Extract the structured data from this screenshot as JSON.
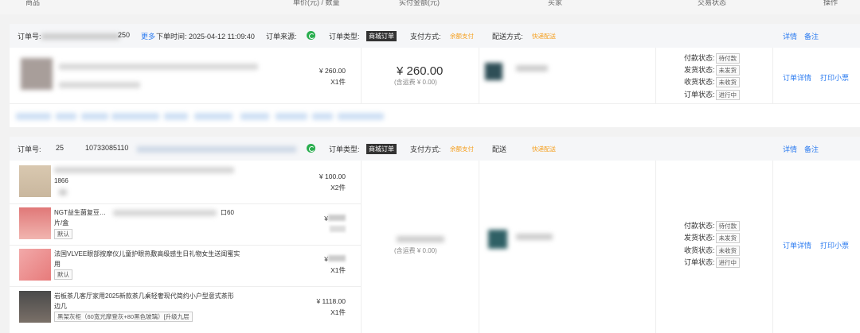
{
  "header": {
    "product": "商品",
    "unit_price_qty": "单价(元) / 数量",
    "paid": "实付金额(元)",
    "buyer": "买家",
    "trade_status": "交易状态",
    "action": "操作"
  },
  "order1": {
    "order_no_label": "订单号:",
    "order_no_suffix": "250",
    "more": "更多",
    "order_time": "下单时间: 2025-04-12 11:09:40",
    "source_label": "订单来源:",
    "type_label": "订单类型:",
    "type_value": "商城订单",
    "pay_label": "支付方式:",
    "pay_value": "余额支付",
    "ship_label": "配送方式:",
    "ship_value": "快递配送",
    "detail": "详情",
    "note": "备注",
    "item_price": "¥ 260.00",
    "item_qty": "X1件",
    "paid_amount": "¥ 260.00",
    "paid_shipping": "(含运费 ¥ 0.00)",
    "status": [
      {
        "label": "付款状态:",
        "value": "待付款"
      },
      {
        "label": "发货状态:",
        "value": "未发货"
      },
      {
        "label": "收货状态:",
        "value": "未收货"
      },
      {
        "label": "订单状态:",
        "value": "进行中"
      }
    ],
    "order_detail": "订单详情",
    "print_ticket": "打印小票"
  },
  "order2": {
    "order_no_label": "订单号:",
    "order_no_value": "25",
    "order_no_partial": "10733085110",
    "type_label": "订单类型:",
    "type_value": "商城订单",
    "pay_label": "支付方式:",
    "pay_value": "余额支付",
    "ship_label": "配送",
    "ship_value": "快递配送",
    "detail": "详情",
    "note": "备注",
    "items": [
      {
        "title": "",
        "line2": "1866",
        "price": "¥ 100.00",
        "qty": "X2件",
        "chip": ""
      },
      {
        "title": "NGT益生菌复豆…",
        "title_tail": "口60",
        "line2": "片/盒",
        "chip": "默认",
        "price": "¥",
        "qty": ""
      },
      {
        "title": "法国VLVEE眼部按摩仪儿童护眼热敷高级感生日礼物女生送闺蜜实",
        "line2": "用",
        "chip": "默认",
        "price": "¥",
        "qty": "X1件"
      },
      {
        "title": "岩板茶几客厅家用2025新款茶几桌轻奢现代简约小户型意式茶形",
        "line2": "边几",
        "chip": "黑架灰柜（60宽光摩登灰+80黑色玻璃）[升级九层",
        "price": "¥ 1118.00",
        "qty": "X1件"
      }
    ],
    "paid_shipping": "(含运费 ¥ 0.00)",
    "status": [
      {
        "label": "付款状态:",
        "value": "待付款"
      },
      {
        "label": "发货状态:",
        "value": "未发货"
      },
      {
        "label": "收货状态:",
        "value": "未收货"
      },
      {
        "label": "订单状态:",
        "value": "进行中"
      }
    ],
    "order_detail": "订单详情",
    "print_ticket": "打印小票"
  }
}
